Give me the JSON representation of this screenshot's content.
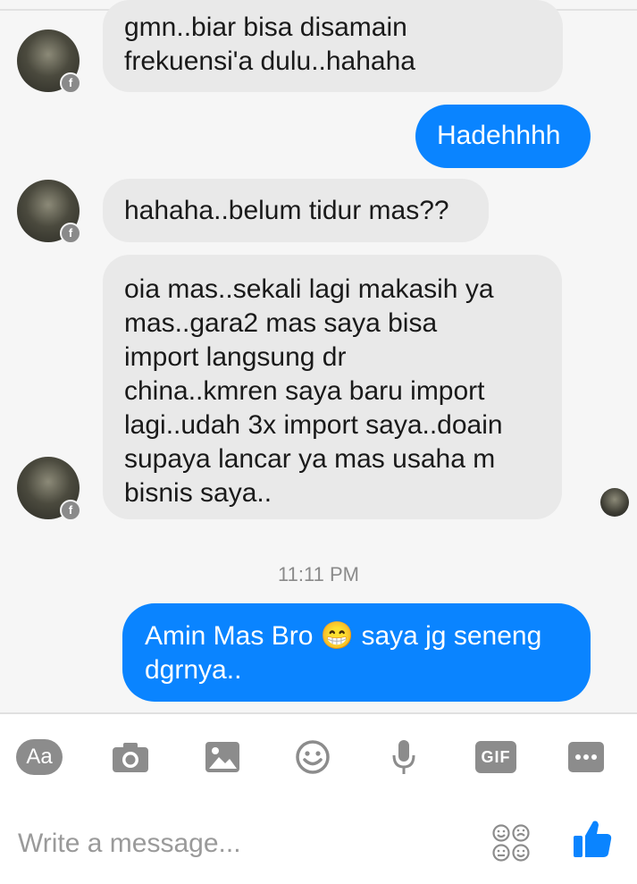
{
  "messages": [
    {
      "side": "in",
      "text": "gmn..biar bisa disamain\nfrekuensi'a dulu..hahaha"
    },
    {
      "side": "out",
      "text": "Hadehhhh"
    },
    {
      "side": "in",
      "text": "hahaha..belum tidur mas??"
    },
    {
      "side": "in",
      "text": "oia mas..sekali lagi makasih ya\nmas..gara2 mas saya bisa\nimport langsung dr\nchina..kmren saya baru import\nlagi..udah 3x import saya..doain\nsupaya lancar ya mas usaha m\nbisnis saya.."
    },
    {
      "side": "out",
      "text_before": "Amin Mas Bro",
      "emoji": "😁",
      "text_after": "saya jg seneng\ndgrnya.."
    }
  ],
  "timestamp": "11:11 PM",
  "toolbar": {
    "aa_label": "Aa",
    "gif_label": "GIF",
    "icons": [
      "text-icon",
      "camera-icon",
      "image-icon",
      "emoji-icon",
      "microphone-icon",
      "gif-icon",
      "more-icon"
    ]
  },
  "composer": {
    "placeholder": "Write a message...",
    "sticker_icon": "sticker-faces-icon",
    "like_icon": "thumbs-up-icon"
  },
  "colors": {
    "outgoing_bubble": "#0a84ff",
    "incoming_bubble": "#e9e9e9",
    "icon_gray": "#8c8c8c",
    "like_blue": "#0a84ff"
  }
}
